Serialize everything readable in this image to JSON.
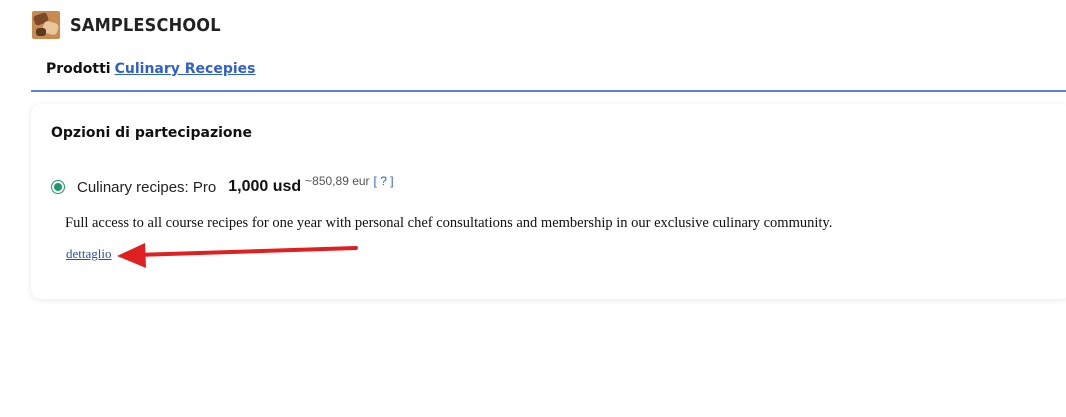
{
  "header": {
    "brand": "SAMPLESCHOOL"
  },
  "breadcrumb": {
    "label": "Prodotti",
    "link": "Culinary Recepies"
  },
  "participation": {
    "title": "Opzioni di partecipazione",
    "option": {
      "name": "Culinary recipes: Pro",
      "price": "1,000 usd",
      "approx": "~850,89 eur",
      "help": "[ ? ]",
      "selected": true,
      "description": "Full access to all course recipes for one year with personal chef consultations and membership in our exclusive culinary community.",
      "detail_link": "dettaglio"
    }
  },
  "colors": {
    "accent": "#2f5fd0",
    "radio": "#1e9a68",
    "annotation_arrow": "#e02020"
  }
}
